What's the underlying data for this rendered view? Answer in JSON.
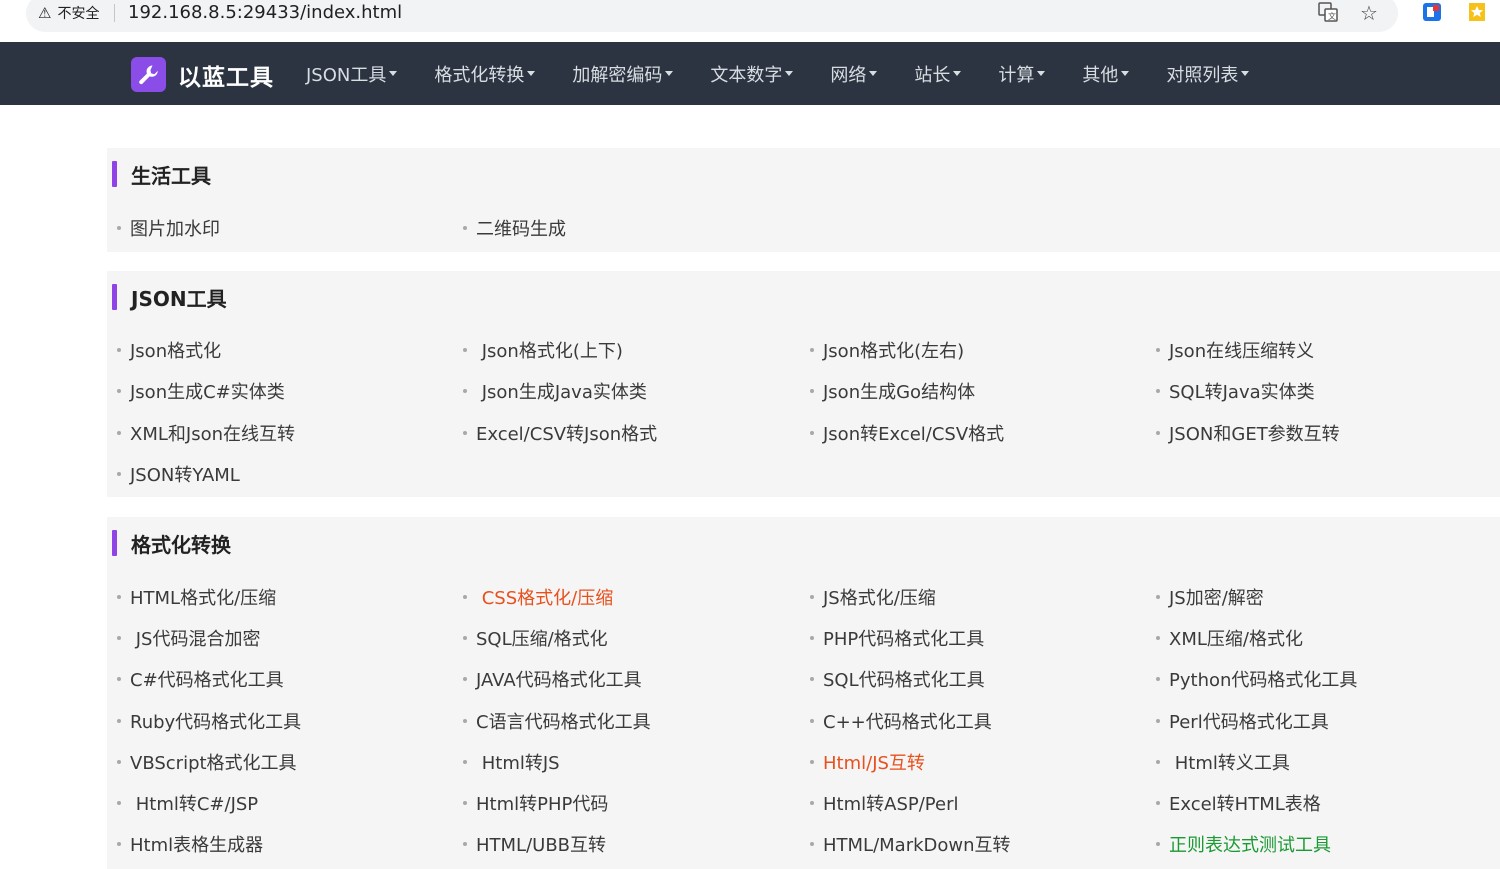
{
  "browser": {
    "security_label": "不安全",
    "url": "192.168.8.5:29433/index.html"
  },
  "nav": {
    "brand": "以蓝工具",
    "items": [
      "JSON工具",
      "格式化转换",
      "加解密编码",
      "文本数字",
      "网络",
      "站长",
      "计算",
      "其他",
      "对照列表"
    ]
  },
  "sections": [
    {
      "title": "生活工具",
      "items": [
        {
          "label": "图片加水印"
        },
        {
          "label": "二维码生成"
        }
      ]
    },
    {
      "title": "JSON工具",
      "items": [
        {
          "label": "Json格式化"
        },
        {
          "label": " Json格式化(上下)"
        },
        {
          "label": "Json格式化(左右)"
        },
        {
          "label": "Json在线压缩转义"
        },
        {
          "label": "Json生成C#实体类"
        },
        {
          "label": " Json生成Java实体类"
        },
        {
          "label": "Json生成Go结构体"
        },
        {
          "label": "SQL转Java实体类"
        },
        {
          "label": "XML和Json在线互转"
        },
        {
          "label": "Excel/CSV转Json格式"
        },
        {
          "label": "Json转Excel/CSV格式"
        },
        {
          "label": "JSON和GET参数互转"
        },
        {
          "label": "JSON转YAML"
        }
      ]
    },
    {
      "title": "格式化转换",
      "items": [
        {
          "label": "HTML格式化/压缩"
        },
        {
          "label": " CSS格式化/压缩",
          "color": "#e8501c"
        },
        {
          "label": "JS格式化/压缩"
        },
        {
          "label": "JS加密/解密"
        },
        {
          "label": " JS代码混合加密"
        },
        {
          "label": "SQL压缩/格式化"
        },
        {
          "label": "PHP代码格式化工具"
        },
        {
          "label": "XML压缩/格式化"
        },
        {
          "label": "C#代码格式化工具"
        },
        {
          "label": "JAVA代码格式化工具"
        },
        {
          "label": "SQL代码格式化工具"
        },
        {
          "label": "Python代码格式化工具"
        },
        {
          "label": "Ruby代码格式化工具"
        },
        {
          "label": "C语言代码格式化工具"
        },
        {
          "label": "C++代码格式化工具"
        },
        {
          "label": "Perl代码格式化工具"
        },
        {
          "label": "VBScript格式化工具"
        },
        {
          "label": " Html转JS"
        },
        {
          "label": "Html/JS互转",
          "color": "#e8501c"
        },
        {
          "label": " Html转义工具"
        },
        {
          "label": " Html转C#/JSP"
        },
        {
          "label": "Html转PHP代码"
        },
        {
          "label": "Html转ASP/Perl"
        },
        {
          "label": "Excel转HTML表格"
        },
        {
          "label": "Html表格生成器"
        },
        {
          "label": "HTML/UBB互转"
        },
        {
          "label": "HTML/MarkDown互转"
        },
        {
          "label": "正则表达式测试工具",
          "color": "#1a9a32"
        }
      ]
    }
  ]
}
